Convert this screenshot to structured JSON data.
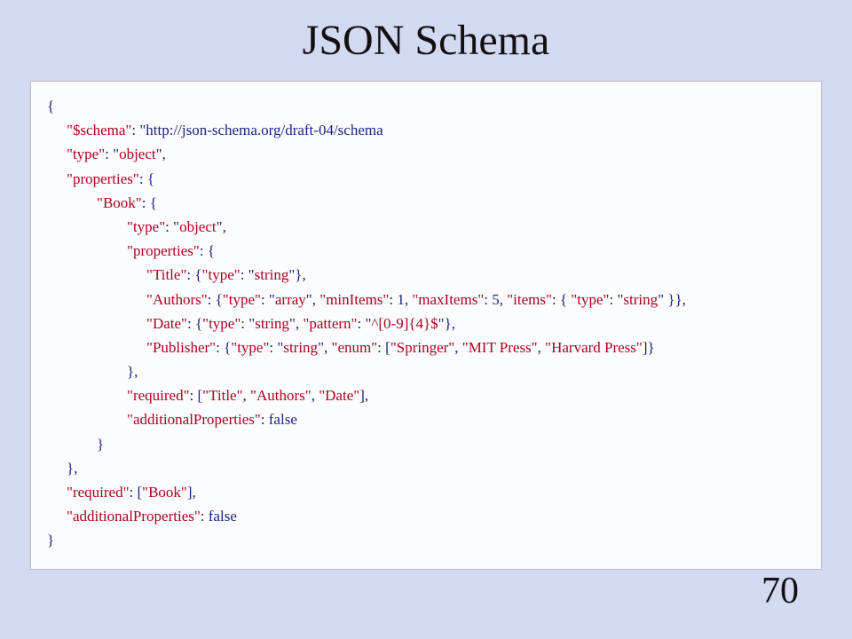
{
  "title": "JSON Schema",
  "page_number": "70",
  "code": {
    "l0": "{",
    "l1_k": "\"$schema\"",
    "l1_v": ": \"http://json-schema.org/draft-04/schema",
    "l2_k": "\"type\"",
    "l2_p1": ": \"",
    "l2_v": "object",
    "l2_p2": "\",",
    "l3_k": "\"properties\"",
    "l3_v": ": {",
    "l4_k": "\"Book\"",
    "l4_v": ": {",
    "l5_k": "\"type\"",
    "l5_p1": ": \"",
    "l5_v": "object",
    "l5_p2": "\",",
    "l6_k": "\"properties\"",
    "l6_v": ": {",
    "l7_k": "\"Title\"",
    "l7_p1": ": {",
    "l7_tk": "\"type\"",
    "l7_tp1": ": \"",
    "l7_tv": "string",
    "l7_tp2": "\"},",
    "l8_k": "\"Authors\"",
    "l8_p1": ": {",
    "l8_tk": "\"type\"",
    "l8_tp1": ": \"",
    "l8_tv": "array",
    "l8_tp2": "\", ",
    "l8_mi_k": "\"minItems\"",
    "l8_mi_v": ": 1, ",
    "l8_mx_k": "\"maxItems\"",
    "l8_mx_v": ": 5, ",
    "l8_it_k": "\"items\"",
    "l8_it_p1": ": { ",
    "l8_it_tk": "\"type\"",
    "l8_it_tp1": ": \"",
    "l8_it_tv": "string",
    "l8_it_tp2": "\" }},",
    "l9_k": "\"Date\"",
    "l9_p1": ": {",
    "l9_tk": "\"type\"",
    "l9_tp1": ": \"",
    "l9_tv": "string",
    "l9_tp2": "\", ",
    "l9_pk": "\"pattern\"",
    "l9_pp1": ": \"",
    "l9_pv": "^[0-9]{4}$",
    "l9_pp2": "\"},",
    "l10_k": "\"Publisher\"",
    "l10_p1": ": {",
    "l10_tk": "\"type\"",
    "l10_tp1": ": \"",
    "l10_tv": "string",
    "l10_tp2": "\", ",
    "l10_ek": "\"enum\"",
    "l10_ep1": ": [",
    "l10_e1": "\"Springer\"",
    "l10_c1": ", ",
    "l10_e2": "\"MIT Press\"",
    "l10_c2": ", ",
    "l10_e3": "\"Harvard Press\"",
    "l10_ep2": "]}",
    "l11": "},",
    "l12_k": "\"required\"",
    "l12_p1": ": [",
    "l12_a": "\"Title\"",
    "l12_c1": ", ",
    "l12_b": "\"Authors\"",
    "l12_c2": ", ",
    "l12_c": "\"Date\"",
    "l12_p2": "],",
    "l13_k": "\"additionalProperties\"",
    "l13_v": ": false",
    "l14": "}",
    "l15": "},",
    "l16_k": "\"required\"",
    "l16_p1": ": [",
    "l16_a": "\"Book\"",
    "l16_p2": "],",
    "l17_k": "\"additionalProperties\"",
    "l17_v": ": false",
    "l18": "}"
  }
}
